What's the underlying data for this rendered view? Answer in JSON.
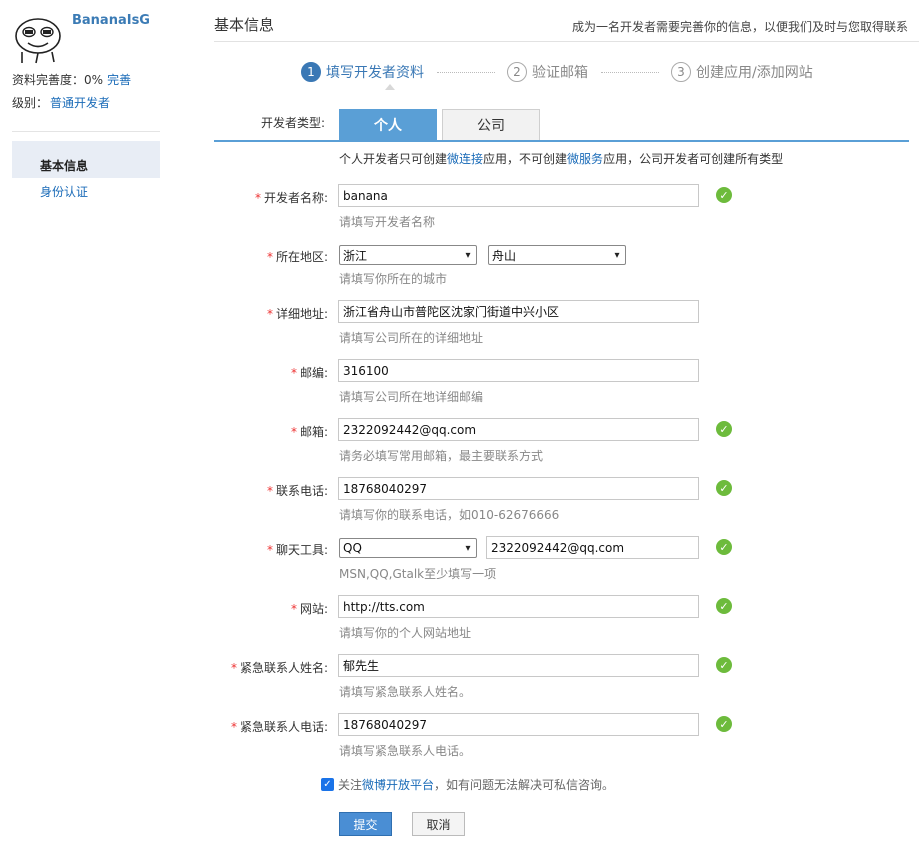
{
  "sidebar": {
    "username": "BananaIsG",
    "completeness_label": "资料完善度：",
    "completeness_value": "0%",
    "completeness_link": "完善",
    "level_label": "级别：",
    "level_value": "普通开发者",
    "nav": [
      {
        "label": "基本信息",
        "active": true
      },
      {
        "label": "身份认证",
        "active": false
      }
    ]
  },
  "header": {
    "title": "基本信息",
    "note": "成为一名开发者需要完善你的信息，以便我们及时与您取得联系"
  },
  "steps": [
    {
      "num": "1",
      "label": "填写开发者资料",
      "active": true
    },
    {
      "num": "2",
      "label": "验证邮箱",
      "active": false
    },
    {
      "num": "3",
      "label": "创建应用/添加网站",
      "active": false
    }
  ],
  "type_selector": {
    "label": "开发者类型:",
    "tabs": [
      {
        "label": "个人",
        "active": true
      },
      {
        "label": "公司",
        "active": false
      }
    ],
    "note_parts": [
      "个人开发者只可创建",
      "微连接",
      "应用，不可创建",
      "微服务",
      "应用，公司开发者可创建所有类型"
    ]
  },
  "form": {
    "name": {
      "label": "开发者名称:",
      "value": "banana",
      "hint": "请填写开发者名称",
      "valid": true
    },
    "region": {
      "label": "所在地区:",
      "province": "浙江",
      "city": "舟山",
      "hint": "请填写你所在的城市"
    },
    "address": {
      "label": "详细地址:",
      "value": "浙江省舟山市普陀区沈家门街道中兴小区",
      "hint": "请填写公司所在的详细地址"
    },
    "postcode": {
      "label": "邮编:",
      "value": "316100",
      "hint": "请填写公司所在地详细邮编"
    },
    "email": {
      "label": "邮箱:",
      "value": "2322092442@qq.com",
      "hint": "请务必填写常用邮箱，最主要联系方式",
      "valid": true
    },
    "phone": {
      "label": "联系电话:",
      "value": "18768040297",
      "hint": "请填写你的联系电话，如010-62676666",
      "valid": true
    },
    "chat": {
      "label": "聊天工具:",
      "tool": "QQ",
      "value": "2322092442@qq.com",
      "hint": "MSN,QQ,Gtalk至少填写一项",
      "valid": true
    },
    "website": {
      "label": "网站:",
      "value": "http://tts.com",
      "hint": "请填写你的个人网站地址",
      "valid": true
    },
    "emergency_name": {
      "label": "紧急联系人姓名:",
      "value": "郁先生",
      "hint": "请填写紧急联系人姓名。",
      "valid": true
    },
    "emergency_phone": {
      "label": "紧急联系人电话:",
      "value": "18768040297",
      "hint": "请填写紧急联系人电话。",
      "valid": true
    },
    "required_mark": "*",
    "check_glyph": "✓"
  },
  "follow": {
    "checked": true,
    "check_glyph": "✓",
    "prefix": "关注",
    "link": "微博开放平台",
    "suffix": "，如有问题无法解决可私信咨询。"
  },
  "buttons": {
    "submit": "提交",
    "cancel": "取消"
  },
  "icons": {
    "select_caret": "▾"
  },
  "colors": {
    "accent": "#3a78b5",
    "tab_active": "#5a9fd6",
    "link": "#1a6bb8",
    "required": "#e33333",
    "valid": "#6dbb3c"
  }
}
